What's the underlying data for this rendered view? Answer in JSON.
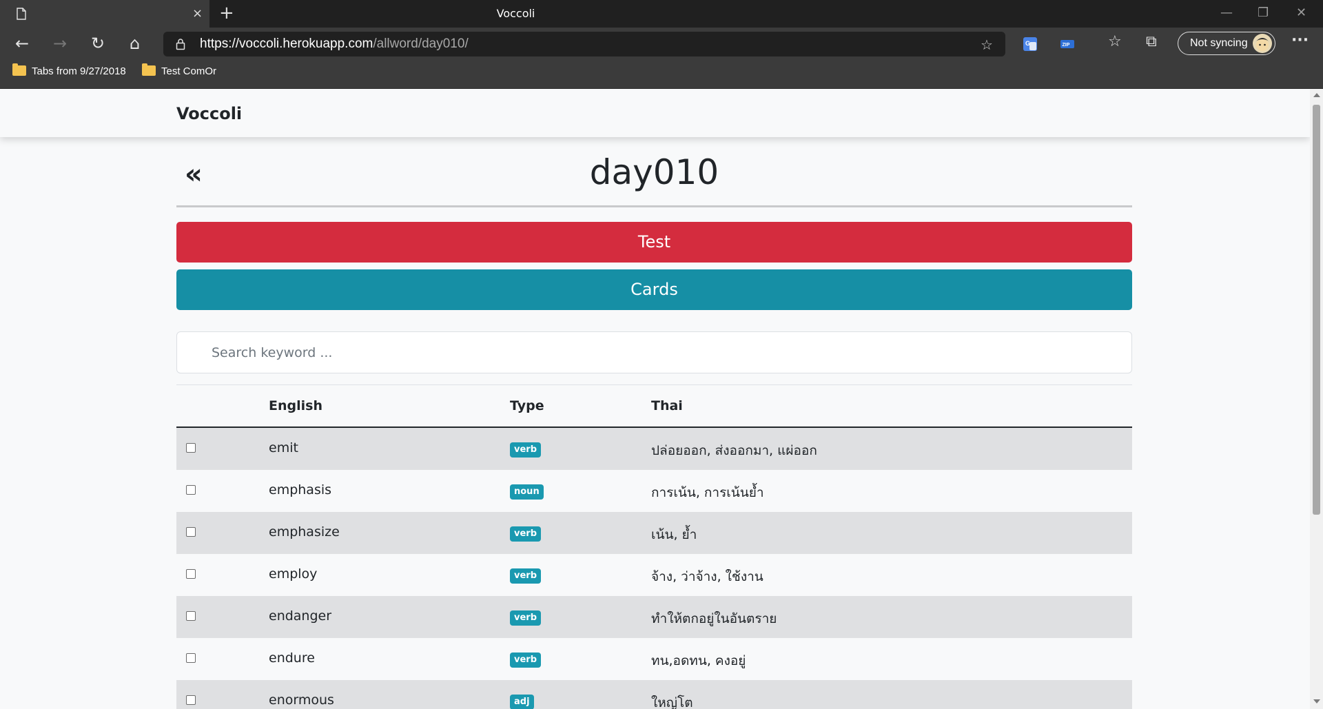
{
  "browser": {
    "tab_title": "Voccoli",
    "url_host": "https://voccoli.herokuapp.com",
    "url_path": "/allword/day010/",
    "sync_label": "Not syncing",
    "bookmarks": [
      {
        "label": "Tabs from 9/27/2018"
      },
      {
        "label": "Test ComOr"
      }
    ],
    "icons": {
      "back": "←",
      "forward": "→",
      "refresh": "↻",
      "home": "⌂",
      "new_tab": "+",
      "close_tab": "×",
      "minimize": "—",
      "restore": "❐",
      "close_window": "✕",
      "favorites": "☆",
      "add_favorite": "☆",
      "collections": "⧉",
      "more": "···"
    }
  },
  "app": {
    "brand": "Voccoli",
    "back_symbol": "«",
    "title": "day010",
    "test_button": "Test",
    "cards_button": "Cards",
    "search_placeholder": "Search keyword ..."
  },
  "table": {
    "headers": {
      "english": "English",
      "type": "Type",
      "thai": "Thai"
    },
    "rows": [
      {
        "english": "emit",
        "type": "verb",
        "thai": "ปล่อยออก, ส่งออกมา, แผ่ออก"
      },
      {
        "english": "emphasis",
        "type": "noun",
        "thai": "การเน้น, การเน้นย้ำ"
      },
      {
        "english": "emphasize",
        "type": "verb",
        "thai": "เน้น, ย้ำ"
      },
      {
        "english": "employ",
        "type": "verb",
        "thai": "จ้าง, ว่าจ้าง, ใช้งาน"
      },
      {
        "english": "endanger",
        "type": "verb",
        "thai": "ทำให้ตกอยู่ในอันตราย"
      },
      {
        "english": "endure",
        "type": "verb",
        "thai": "ทน,อดทน, คงอยู่"
      },
      {
        "english": "enormous",
        "type": "adj",
        "thai": "ใหญ่โต"
      }
    ]
  },
  "colors": {
    "test_button": "#d42c3e",
    "cards_button": "#168fa5",
    "type_badge": "#1a99b0",
    "striped_row": "#dfe0e2"
  }
}
